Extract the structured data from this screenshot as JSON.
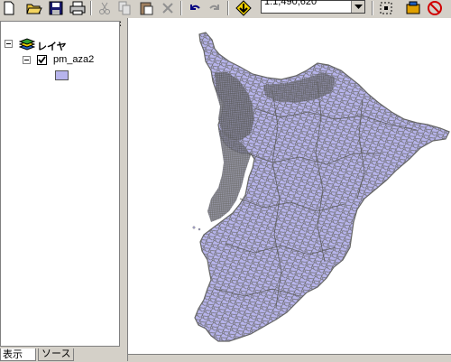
{
  "toolbar": {
    "buttons": [
      "new-document",
      "open",
      "save",
      "print",
      "cut",
      "copy",
      "paste",
      "delete",
      "undo",
      "redo",
      "add-data",
      "identify-results",
      "arc-toolbox",
      "stop"
    ],
    "scale_value": "1:1,490,620"
  },
  "toc": {
    "root_label": "レイヤ",
    "layer_name": "pm_aza2",
    "legend_color": "#b7b4ec",
    "close_glyph": "×"
  },
  "tabs": {
    "display": "表示",
    "source": "ソース"
  },
  "map": {
    "fill_color": "#b7b4ec",
    "boundary_color": "#666666"
  }
}
